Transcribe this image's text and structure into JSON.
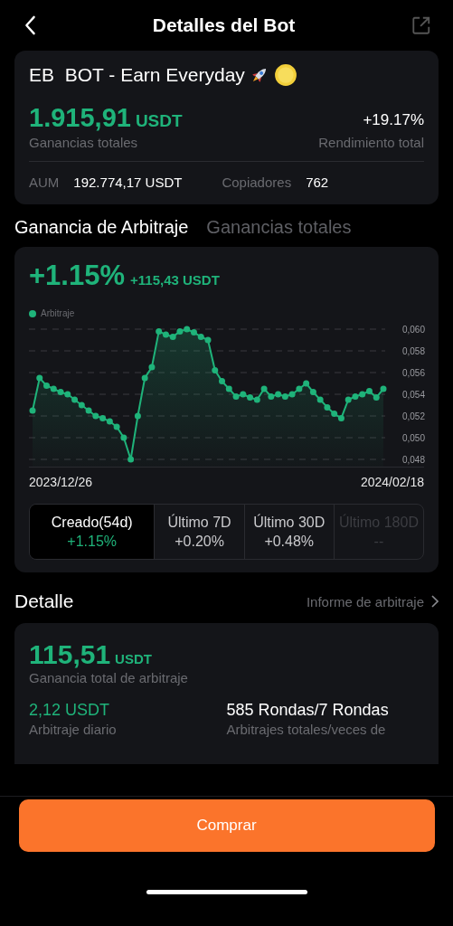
{
  "header": {
    "title": "Detalles del Bot"
  },
  "bot": {
    "name": "EB  BOT - Earn Everyday",
    "total_profit": "1.915,91",
    "total_profit_unit": "USDT",
    "total_profit_label": "Ganancias totales",
    "total_return": "+19.17%",
    "total_return_label": "Rendimiento total",
    "aum_label": "AUM",
    "aum": "192.774,17 USDT",
    "copiers_label": "Copiadores",
    "copiers": "762"
  },
  "tabs": [
    {
      "label": "Ganancia de Arbitraje",
      "selected": true
    },
    {
      "label": "Ganancias totales",
      "selected": false
    }
  ],
  "chart_card": {
    "percent": "+1.15%",
    "amount": "+115,43 USDT",
    "chart_data": {
      "type": "area",
      "grid": true,
      "ylim": [
        0.048,
        0.06
      ],
      "series": [
        {
          "name": "Arbitraje",
          "color": "#1fb37a",
          "values": [
            0.0525,
            0.0555,
            0.0548,
            0.0545,
            0.0542,
            0.054,
            0.0535,
            0.053,
            0.0525,
            0.052,
            0.0518,
            0.0515,
            0.051,
            0.05,
            0.048,
            0.052,
            0.0555,
            0.0565,
            0.0598,
            0.0595,
            0.0593,
            0.0598,
            0.06,
            0.0597,
            0.0593,
            0.059,
            0.0562,
            0.0552,
            0.0545,
            0.0538,
            0.054,
            0.0537,
            0.0535,
            0.0545,
            0.0538,
            0.054,
            0.0538,
            0.054,
            0.0545,
            0.055,
            0.0542,
            0.0535,
            0.0528,
            0.0522,
            0.0518,
            0.0535,
            0.0538,
            0.054,
            0.0543,
            0.0537,
            0.0545
          ]
        }
      ],
      "yticks": [
        {
          "value": 0.048,
          "label": "0,048"
        },
        {
          "value": 0.05,
          "label": "0,050"
        },
        {
          "value": 0.052,
          "label": "0,052"
        },
        {
          "value": 0.054,
          "label": "0,054"
        },
        {
          "value": 0.056,
          "label": "0,056"
        },
        {
          "value": 0.058,
          "label": "0,058"
        },
        {
          "value": 0.06,
          "label": "0,060"
        }
      ]
    },
    "start_date": "2023/12/26",
    "end_date": "2024/02/18",
    "periods": [
      {
        "label": "Creado(54d)",
        "value": "+1.15%",
        "selected": true,
        "disabled": false
      },
      {
        "label": "Último 7D",
        "value": "+0.20%",
        "selected": false,
        "disabled": false
      },
      {
        "label": "Último 30D",
        "value": "+0.48%",
        "selected": false,
        "disabled": false
      },
      {
        "label": "Último 180D",
        "value": "--",
        "selected": false,
        "disabled": true
      }
    ]
  },
  "detail": {
    "title": "Detalle",
    "report_link": "Informe de arbitraje",
    "total": "115,51",
    "total_unit": "USDT",
    "total_label": "Ganancia total de arbitraje",
    "daily": "2,12 USDT",
    "daily_label": "Arbitraje diario",
    "rounds": "585 Rondas/7 Rondas",
    "rounds_label": "Arbitrajes totales/veces de"
  },
  "buy_button": "Comprar"
}
